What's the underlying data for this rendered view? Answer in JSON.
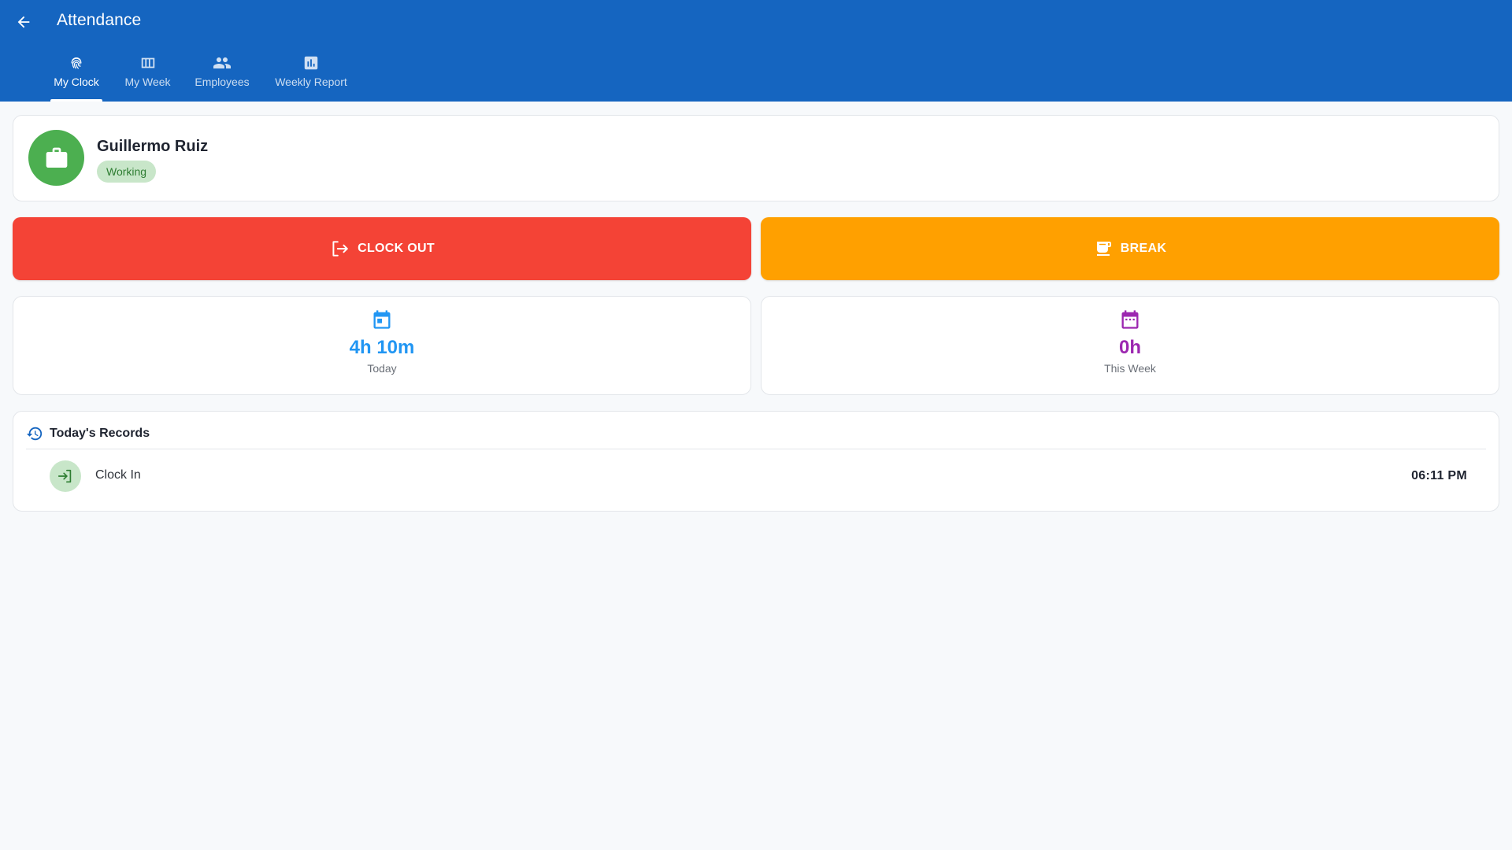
{
  "appbar": {
    "title": "Attendance",
    "back_icon": "arrow-back-icon",
    "background": "#1565c0"
  },
  "tabs": [
    {
      "label": "My Clock",
      "icon": "fingerprint-icon",
      "active": true
    },
    {
      "label": "My Week",
      "icon": "week-columns-icon",
      "active": false
    },
    {
      "label": "Employees",
      "icon": "people-icon",
      "active": false
    },
    {
      "label": "Weekly Report",
      "icon": "bar-chart-icon",
      "active": false
    }
  ],
  "profile": {
    "name": "Guillermo Ruiz",
    "status": "Working",
    "avatar_icon": "briefcase-icon",
    "avatar_color": "#4caf50"
  },
  "actions": {
    "clock_out_label": "CLOCK OUT",
    "clock_out_icon": "logout-icon",
    "clock_out_color": "#f44336",
    "break_label": "BREAK",
    "break_icon": "coffee-icon",
    "break_color": "#ffa000"
  },
  "stats": {
    "today": {
      "value": "4h 10m",
      "label": "Today",
      "icon": "calendar-today-icon",
      "color": "#2196f3"
    },
    "week": {
      "value": "0h",
      "label": "This Week",
      "icon": "calendar-month-icon",
      "color": "#9c27b0"
    }
  },
  "records": {
    "title": "Today's Records",
    "icon": "history-icon",
    "items": [
      {
        "type": "Clock In",
        "time": "06:11 PM",
        "icon": "login-icon"
      }
    ]
  }
}
